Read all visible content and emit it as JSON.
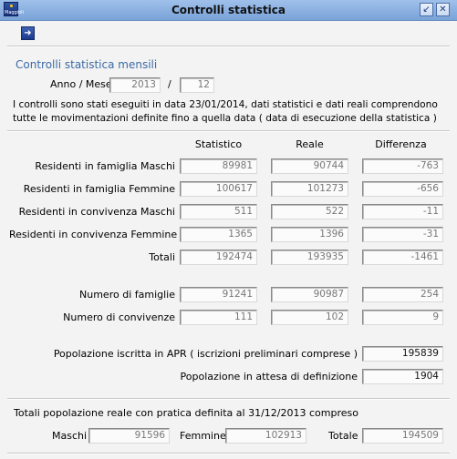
{
  "window": {
    "title": "Controlli statistica",
    "icon_text": "Maggioli"
  },
  "toolbar": {
    "forward_icon": "arrow-right-icon"
  },
  "section_title": "Controlli statistica mensili",
  "period": {
    "label": "Anno / Mese",
    "year": "2013",
    "separator": "/",
    "month": "12"
  },
  "description": "I controlli sono stati eseguiti in data 23/01/2014, dati statistici e dati reali comprendono tutte le movimentazioni definite fino a quella data ( data di esecuzione della statistica )",
  "columns": {
    "statistico": "Statistico",
    "reale": "Reale",
    "differenza": "Differenza"
  },
  "rows": [
    {
      "label": "Residenti in famiglia Maschi",
      "statistico": "89981",
      "reale": "90744",
      "differenza": "-763"
    },
    {
      "label": "Residenti in famiglia Femmine",
      "statistico": "100617",
      "reale": "101273",
      "differenza": "-656"
    },
    {
      "label": "Residenti in convivenza Maschi",
      "statistico": "511",
      "reale": "522",
      "differenza": "-11"
    },
    {
      "label": "Residenti in convivenza Femmine",
      "statistico": "1365",
      "reale": "1396",
      "differenza": "-31"
    },
    {
      "label": "Totali",
      "statistico": "192474",
      "reale": "193935",
      "differenza": "-1461"
    },
    {
      "label": "Numero di famiglie",
      "statistico": "91241",
      "reale": "90987",
      "differenza": "254"
    },
    {
      "label": "Numero di convivenze",
      "statistico": "111",
      "reale": "102",
      "differenza": "9"
    }
  ],
  "apr": {
    "label": "Popolazione iscritta in APR ( iscrizioni preliminari comprese )",
    "value": "195839"
  },
  "attesa": {
    "label": "Popolazione in attesa di definizione",
    "value": "1904"
  },
  "totali_reali": {
    "caption": "Totali popolazione reale con pratica definita al 31/12/2013 compreso",
    "maschi_label": "Maschi",
    "maschi": "91596",
    "femmine_label": "Femmine",
    "femmine": "102913",
    "totale_label": "Totale",
    "totale": "194509"
  }
}
